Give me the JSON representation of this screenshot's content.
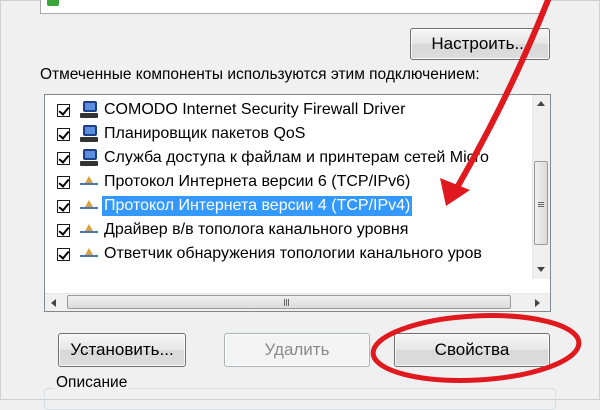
{
  "buttons": {
    "configure": "Настроить...",
    "install": "Установить...",
    "remove": "Удалить",
    "properties": "Свойства"
  },
  "components_caption": "Отмеченные компоненты используются этим подключением:",
  "components": [
    {
      "label": "COMODO Internet Security Firewall Driver",
      "checked": true,
      "icon": "network-adapter-icon",
      "selected": false
    },
    {
      "label": "Планировщик пакетов QoS",
      "checked": true,
      "icon": "network-adapter-icon",
      "selected": false
    },
    {
      "label": "Служба доступа к файлам и принтерам сетей Micro",
      "checked": true,
      "icon": "network-adapter-icon",
      "selected": false
    },
    {
      "label": "Протокол Интернета версии 6 (TCP/IPv6)",
      "checked": true,
      "icon": "protocol-icon",
      "selected": false
    },
    {
      "label": "Протокол Интернета версии 4 (TCP/IPv4)",
      "checked": true,
      "icon": "protocol-icon",
      "selected": true
    },
    {
      "label": "Драйвер в/в тополога канального уровня",
      "checked": true,
      "icon": "protocol-icon",
      "selected": false
    },
    {
      "label": "Ответчик обнаружения топологии канального уров",
      "checked": true,
      "icon": "protocol-icon",
      "selected": false
    }
  ],
  "description_label": "Описание",
  "colors": {
    "selection": "#3399ff",
    "annotation": "#e0191f"
  }
}
